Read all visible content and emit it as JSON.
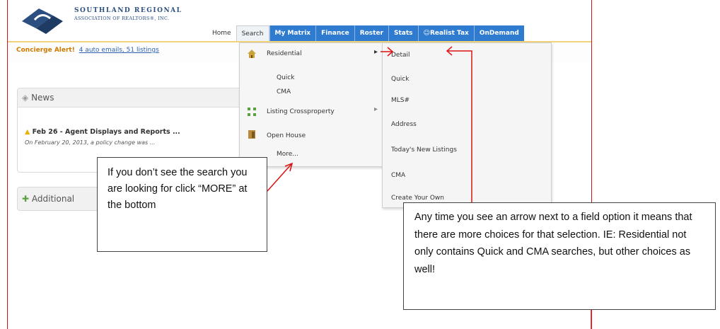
{
  "logo": {
    "line1": "SOUTHLAND REGIONAL",
    "line2": "ASSOCIATION OF REALTORS®, INC."
  },
  "nav": {
    "tabs": [
      {
        "label": "Home"
      },
      {
        "label": "Search"
      },
      {
        "label": "My Matrix"
      },
      {
        "label": "Finance"
      },
      {
        "label": "Roster"
      },
      {
        "label": "Stats"
      },
      {
        "label": "Realist Tax"
      },
      {
        "label": "OnDemand"
      }
    ]
  },
  "alert": {
    "label": "Concierge Alert!",
    "link": "4 auto emails, 51 listings"
  },
  "news": {
    "heading": "News",
    "title": "Feb 26 - Agent Displays and Reports ...",
    "subtitle": "On February 20, 2013, a policy change was ..."
  },
  "additional": {
    "heading": "Additional"
  },
  "dropdown": {
    "residential": "Residential",
    "quick": "Quick",
    "cma": "CMA",
    "crossproperty": "Listing Crossproperty",
    "open_house": "Open House",
    "more": "More..."
  },
  "submenu": {
    "items": [
      "Detail",
      "Quick",
      "MLS#",
      "Address",
      "Today's New Listings",
      "CMA",
      "Create Your Own"
    ]
  },
  "callouts": {
    "more": "If you don’t see the search you are looking for click “MORE” at the bottom",
    "arrow": "Any time you see an arrow next to a field option it means that there are more choices for that selection. IE: Residential not only contains Quick and CMA searches, but other choices as well!"
  },
  "colors": {
    "annotation_red": "#dd1111",
    "nav_blue": "#2f7bd0"
  }
}
